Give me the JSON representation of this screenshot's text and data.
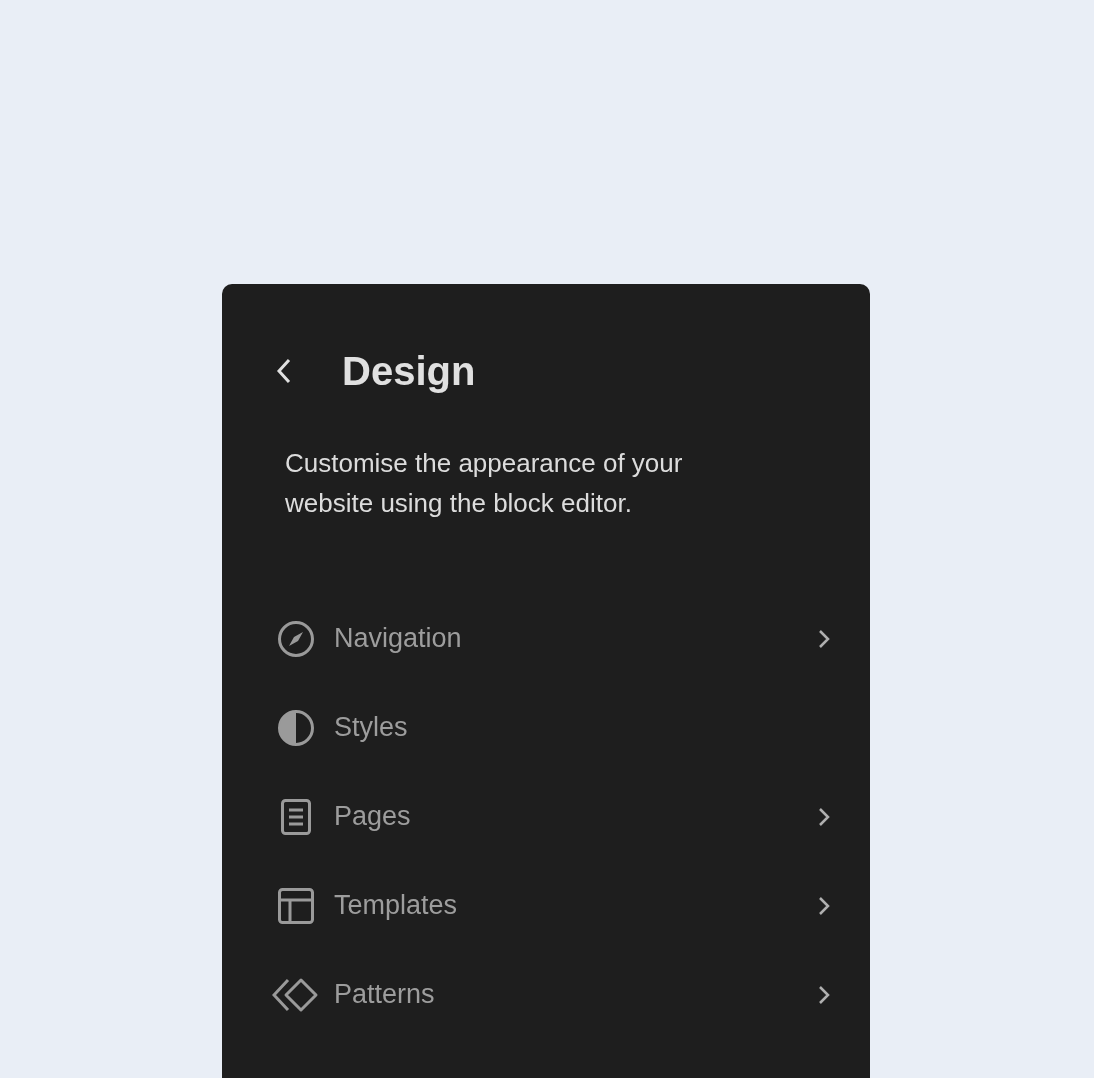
{
  "header": {
    "title": "Design"
  },
  "description": "Customise the appearance of your website using the block editor.",
  "menu": [
    {
      "label": "Navigation",
      "kind": "compass",
      "has_submenu": true
    },
    {
      "label": "Styles",
      "kind": "contrast",
      "has_submenu": false
    },
    {
      "label": "Pages",
      "kind": "page",
      "has_submenu": true
    },
    {
      "label": "Templates",
      "kind": "layout",
      "has_submenu": true
    },
    {
      "label": "Patterns",
      "kind": "diamonds",
      "has_submenu": true
    }
  ]
}
